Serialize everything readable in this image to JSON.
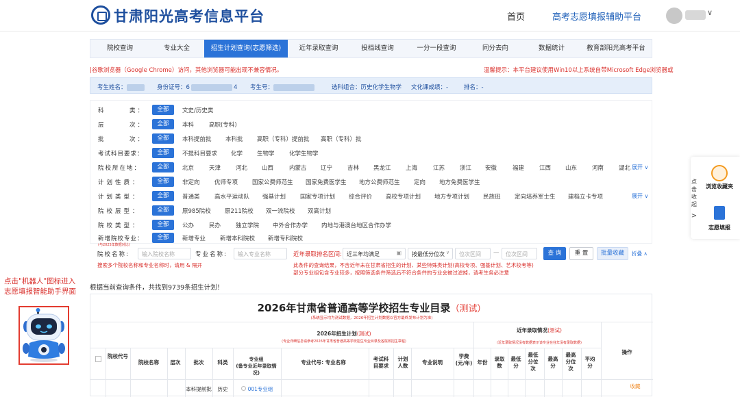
{
  "header": {
    "site_title": "甘肃阳光高考信息平台",
    "nav_home": "首页",
    "nav_assistant": "高考志愿填报辅助平台",
    "user_caret": "∨"
  },
  "tabs": [
    {
      "label": "院校查询"
    },
    {
      "label": "专业大全"
    },
    {
      "label": "招生计划查询(志愿筛选)",
      "active": true
    },
    {
      "label": "近年录取查询"
    },
    {
      "label": "投档线查询"
    },
    {
      "label": "一分一段查询"
    },
    {
      "label": "同分去向"
    },
    {
      "label": "数据统计"
    },
    {
      "label": "教育部阳光高考平台"
    }
  ],
  "notices": {
    "left": "|谷歌浏览器（Google Chrome）访问，其他浏览器可能出现不兼容情况。",
    "right": "温馨提示：本平台建议使用Win10以上系统自带Microsoft Edge浏览器或"
  },
  "candidate_info": {
    "name_label": "考生姓名：",
    "id_label": "身份证号：",
    "id_value_start": "6",
    "id_value_end": "4",
    "exam_no_label": "考生号：",
    "subjects": "选科组合：历史化学生物学",
    "culture_score": "文化课成绩：-",
    "rank": "排名：-"
  },
  "filters": {
    "all_label": "全部",
    "rows": [
      {
        "label": "科　　　类：",
        "options": [
          "文史/历史类"
        ]
      },
      {
        "label": "层　　　次：",
        "options": [
          "本科",
          "高职(专科)"
        ]
      },
      {
        "label": "批　　　次：",
        "options": [
          "本科提前批",
          "本科批",
          "高职（专科）提前批",
          "高职（专科）批"
        ]
      },
      {
        "label": "考试科目要求：",
        "options": [
          "不提科目要求",
          "化学",
          "生物学",
          "化学生物学"
        ]
      },
      {
        "label": "院校所在地：",
        "options": [
          "北京",
          "天津",
          "河北",
          "山西",
          "内蒙古",
          "辽宁",
          "吉林",
          "黑龙江",
          "上海",
          "江苏",
          "浙江",
          "安徽",
          "福建",
          "江西",
          "山东",
          "河南",
          "湖北"
        ],
        "expand": "展开 ∨"
      },
      {
        "label": "计划性质：",
        "options": [
          "非定向",
          "优师专项",
          "国家公费师范生",
          "国家免费医学生",
          "地方公费师范生",
          "定向",
          "地方免费医学生"
        ]
      },
      {
        "label": "计划类型：",
        "options": [
          "普通类",
          "高水平运动队",
          "强基计划",
          "国家专项计划",
          "综合评价",
          "高校专项计划",
          "地方专项计划",
          "民族班",
          "定向培养军士生",
          "建档立卡专项"
        ],
        "expand": "展开 ∨"
      },
      {
        "label": "院校层型：",
        "options": [
          "原985院校",
          "原211院校",
          "双一流院校",
          "双高计划"
        ]
      },
      {
        "label": "院校类型：",
        "options": [
          "公办",
          "民办",
          "独立学院",
          "中外合作办学",
          "内地与港澳台地区合作办学"
        ]
      },
      {
        "label": "新增院校专业：",
        "options": [
          "新增专业",
          "新增本科院校",
          "新增专科院校"
        ],
        "note": "(与2025年数据对比)"
      }
    ]
  },
  "search": {
    "school_label": "院校名称:",
    "school_placeholder": "输入院校名称",
    "major_label": "专业名称:",
    "major_placeholder": "输入专业名称",
    "rank_range_label": "近年录取排名区间:",
    "years_value": "近三年均满足",
    "order_value": "按最低分位次",
    "rank_min_placeholder": "位次区间",
    "rank_max_placeholder": "位次区间",
    "query_button": "查 询",
    "reset_button": "重 置",
    "batch_button": "批量收藏",
    "collapse_button": "折叠 ∧",
    "hint_left": "搜索多个院校名称和专业名称时，请用 & 隔开",
    "hint_right_1": "此条件的查询结果，不含近年未在甘肃省招生的计划、某些特殊类计划(高校专项、强基计划、艺术校考等)",
    "hint_right_2": "部分专业组包含专业较多，按照筛选条件筛选后不符合条件的专业会被过滤掉，请考生务必注意"
  },
  "result_count": "根据当前查询条件，共找到9739条招生计划！",
  "robot_note": {
    "line1": "点击\"机器人\"图标进入",
    "line2": "志愿填报智能助手界面"
  },
  "catalog": {
    "title": "2026年甘肃省普通高等学校招生专业目录",
    "title_tag": "（测试）",
    "subtitle": "(系统显示均为测试数据，2026年招生计划数据以官方最终发布计划为准)",
    "plan_group_title": "2026年招生计划",
    "plan_group_tag": "(测试)",
    "plan_group_note": "(专业详细信息请参考2026年甘肃省普通高等学校招生专业目录及各院校招生章程)",
    "history_group_title": "近年录取情况",
    "history_group_tag": "(测试)",
    "history_group_note": "(近年录取情况没有数据表示该专业在往年没有录取数据)",
    "operation": "操作",
    "columns": [
      "院校代号",
      "院校名称",
      "层次",
      "批次",
      "科类",
      "专业组\n(备专业近年录取情况)",
      "专业代号: 专业名称",
      "考试科目要求",
      "计划人数",
      "专业说明",
      "学费\n(元/年)",
      "年份",
      "录取数",
      "最低分",
      "最低分位次",
      "最高分",
      "最高分位次",
      "平均分"
    ],
    "first_row": {
      "batch": "本科提前批",
      "category": "历史",
      "group": "001专业组",
      "favorite": "收藏"
    }
  },
  "side_panel": {
    "collapse_text": "点击收起",
    "arrow": ">",
    "browse_favorites": "浏览收藏夹",
    "fill_volunteer": "志愿填报"
  },
  "colors": {
    "primary": "#2b73d8",
    "brand": "#1e4f9e",
    "alert": "#d9302c"
  }
}
